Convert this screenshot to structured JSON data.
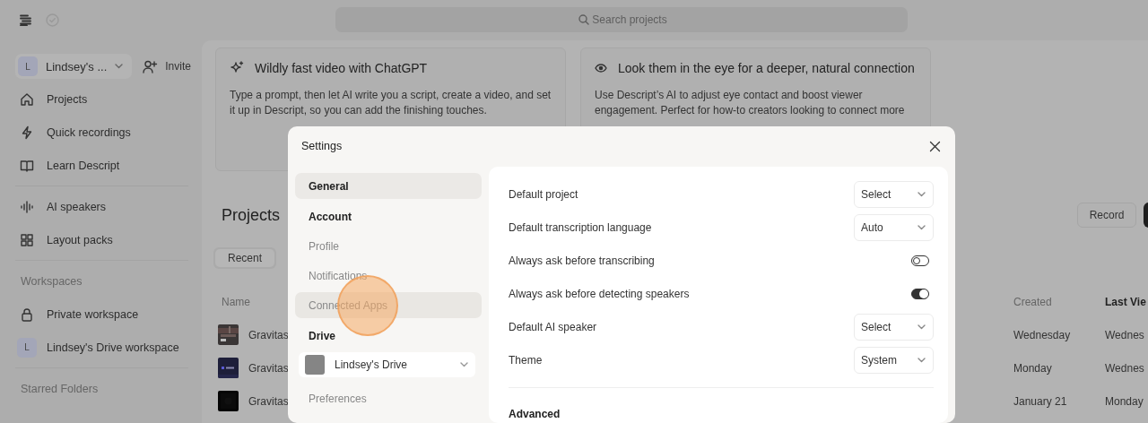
{
  "top_bar": {
    "search": {
      "placeholder": "Search projects"
    }
  },
  "sidebar": {
    "account": {
      "avatar": "L",
      "name": "Lindsey's ..."
    },
    "invite": "Invite",
    "sections": [
      {
        "items": [
          {
            "kind": "icon",
            "label": "Projects"
          },
          {
            "kind": "icon",
            "label": "Quick recordings"
          },
          {
            "kind": "icon",
            "label": "Learn Descript"
          }
        ]
      },
      {
        "items": [
          {
            "kind": "icon",
            "label": "AI speakers"
          },
          {
            "kind": "icon",
            "label": "Layout packs"
          }
        ]
      },
      {
        "title": "Workspaces",
        "items": [
          {
            "kind": "icon",
            "label": "Private workspace"
          },
          {
            "kind": "avatar",
            "avatar": "L",
            "label": "Lindsey's Drive workspace"
          }
        ]
      },
      {
        "title": "Starred Folders"
      }
    ]
  },
  "cards": [
    {
      "title": "Wildly fast video with ChatGPT",
      "body": "Type a prompt, then let AI write you a script, create a video, and set it up in Descript, so you can add the finishing touches."
    },
    {
      "title": "Look them in the eye for a deeper, natural connection",
      "body": "Use Descript’s AI to adjust eye contact and boost viewer engagement. Perfect for how-to creators looking to connect more"
    }
  ],
  "projects": {
    "title": "Projects",
    "record": "Record",
    "tabs": [
      {
        "label": "Recent",
        "selected": true
      }
    ],
    "columns": [
      "Name",
      "Created",
      "Last Vie"
    ],
    "rows": [
      {
        "name": "Gravitas",
        "created": "Wednesday",
        "last_viewed": "Wednes"
      },
      {
        "name": "Gravitas",
        "created": "Monday",
        "last_viewed": "Wednes"
      },
      {
        "name": "Gravitas",
        "created": "January 21",
        "last_viewed": "Monday"
      }
    ]
  },
  "settings": {
    "title": "Settings",
    "nav": [
      {
        "kind": "item",
        "label": "General",
        "selected": true,
        "hovered": false
      },
      {
        "kind": "heading",
        "label": "Account"
      },
      {
        "kind": "item",
        "label": "Profile",
        "selected": false,
        "hovered": false
      },
      {
        "kind": "item",
        "label": "Notifications",
        "selected": false,
        "hovered": false
      },
      {
        "kind": "item",
        "label": "Connected Apps",
        "selected": false,
        "hovered": true
      },
      {
        "kind": "heading",
        "label": "Drive"
      },
      {
        "kind": "select",
        "label": "Lindsey's Drive"
      },
      {
        "kind": "item",
        "label": "Preferences",
        "selected": false,
        "hovered": false
      }
    ],
    "rows": [
      {
        "kind": "select",
        "label": "Default project",
        "value": "Select"
      },
      {
        "kind": "select",
        "label": "Default transcription language",
        "value": "Auto"
      },
      {
        "kind": "toggle",
        "label": "Always ask before transcribing",
        "on": false
      },
      {
        "kind": "toggle",
        "label": "Always ask before detecting speakers",
        "on": true
      },
      {
        "kind": "select",
        "label": "Default AI speaker",
        "value": "Select"
      },
      {
        "kind": "select",
        "label": "Theme",
        "value": "System"
      }
    ],
    "section": "Advanced"
  }
}
